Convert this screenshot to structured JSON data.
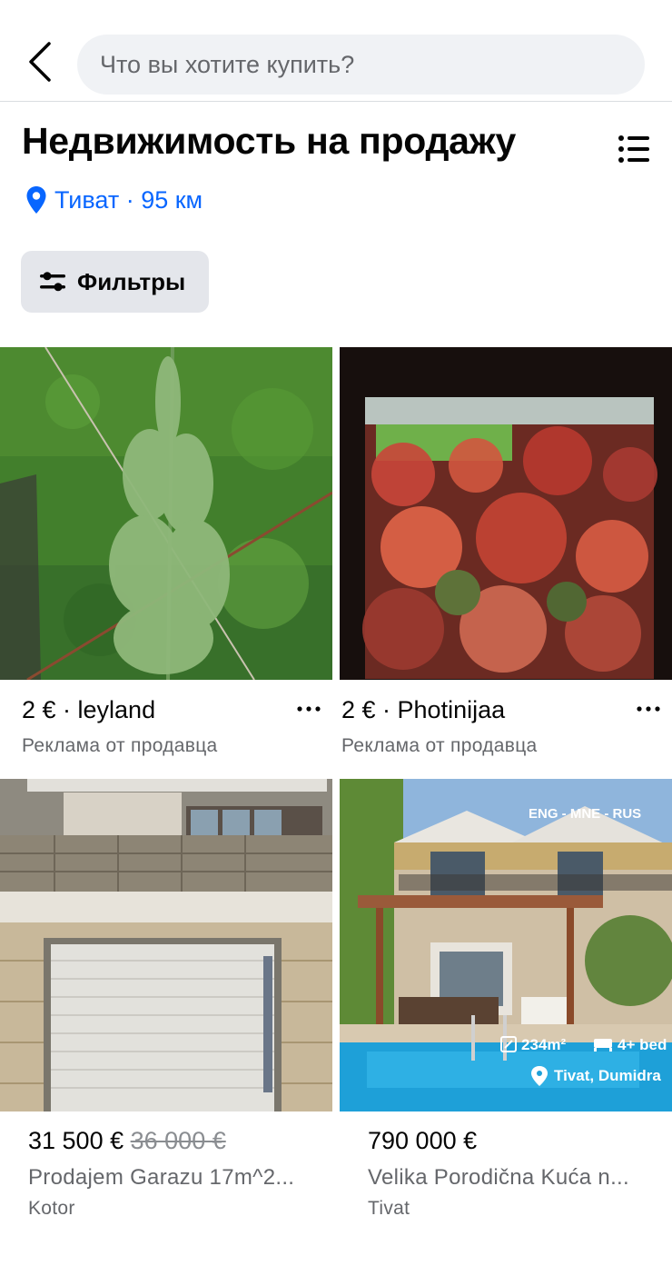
{
  "header": {
    "search_placeholder": "Что вы хотите купить?"
  },
  "page": {
    "title": "Недвижимость на продажу",
    "location": "Тиват · 95 км",
    "filters_label": "Фильтры"
  },
  "listings": [
    {
      "title": "2 € · leyland",
      "subtitle": "Реклама от продавца"
    },
    {
      "title": "2 € · Photinijaa",
      "subtitle": "Реклама от продавца"
    },
    {
      "price": "31 500 €",
      "old_price": "36 000 €",
      "name": "Prodajem Garazu 17m^2...",
      "city": "Kotor"
    },
    {
      "price": "790 000 €",
      "name": "Velika Porodična Kuća n...",
      "city": "Tivat",
      "overlay": {
        "langs": "ENG - MNE - RUS",
        "area": "234m²",
        "beds": "4+ bed",
        "place": "Tivat, Dumidra"
      }
    }
  ],
  "colors": {
    "accent": "#0866ff",
    "secondary_text": "#65676b",
    "chip_bg": "#e4e6eb",
    "search_bg": "#f0f2f5"
  }
}
